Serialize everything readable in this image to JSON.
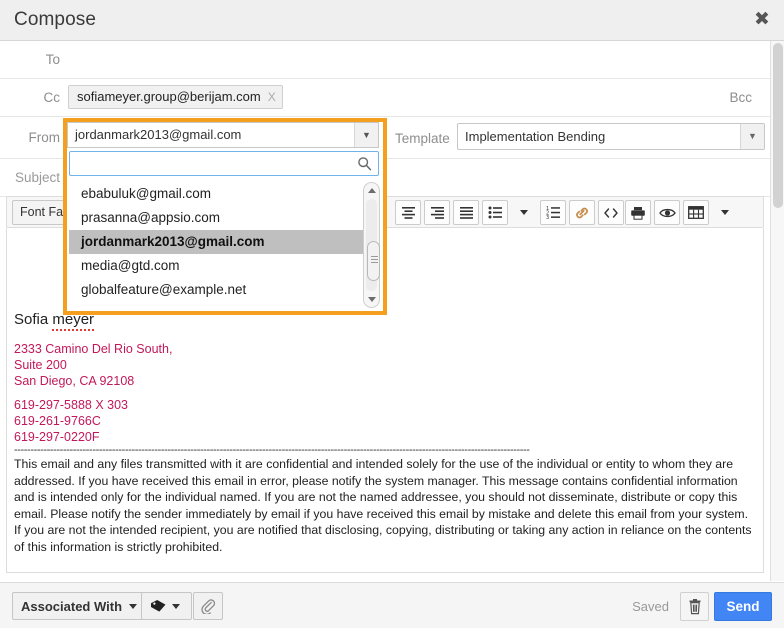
{
  "window": {
    "title": "Compose",
    "close_label": "✖"
  },
  "fields": {
    "to": {
      "label": "To",
      "value": ""
    },
    "cc": {
      "label": "Cc",
      "chip": "sofiameyer.group@berijam.com",
      "chip_remove": "X"
    },
    "bcc": {
      "label": "Bcc"
    },
    "from": {
      "label": "From",
      "value": "jordanmark2013@gmail.com"
    },
    "subject": {
      "label": "Subject",
      "value": ""
    }
  },
  "template": {
    "label": "Template",
    "value": "Implementation Bending"
  },
  "from_dropdown": {
    "open": true,
    "selected": "jordanmark2013@gmail.com",
    "search_value": "",
    "search_placeholder": "",
    "options": [
      "ebabuluk@gmail.com",
      "prasanna@appsio.com",
      "jordanmark2013@gmail.com",
      "media@gtd.com",
      "globalfeature@example.net"
    ],
    "highlight_color": "#f59f1e"
  },
  "toolbar": {
    "font_family_label": "Font Fami",
    "buttons": [
      {
        "name": "align-center-icon",
        "label": ""
      },
      {
        "name": "align-right-icon",
        "label": ""
      },
      {
        "name": "align-justify-icon",
        "label": ""
      },
      {
        "name": "bullet-list-icon",
        "label": ""
      },
      {
        "name": "numbered-list-icon",
        "label": ""
      },
      {
        "name": "link-icon",
        "label": ""
      },
      {
        "name": "source-code-icon",
        "label": ""
      },
      {
        "name": "print-icon",
        "label": ""
      },
      {
        "name": "preview-eye-icon",
        "label": ""
      },
      {
        "name": "table-icon",
        "label": ""
      }
    ]
  },
  "body": {
    "signature_name": "Sofia ",
    "signature_name_misspelled": "meyer",
    "address_line1": "2333 Camino Del Rio South,",
    "address_line2": "Suite 200",
    "address_line3": "San Diego, CA 92108",
    "phone1": "619-297-5888 X 303",
    "phone2": "619-261-9766C",
    "phone3": "619-297-0220F",
    "divider": "--------------------------------------------------------------------------------------------------------------------------------------------------------------",
    "disclaimer": "This email and any files transmitted with it are confidential and intended solely for the use of the individual or entity to whom they are addressed. If you have received this email in error, please notify the system manager. This message contains confidential information and is intended only for the individual named. If you are not the named addressee, you should not disseminate, distribute or copy this email. Please notify the sender immediately by email if you have received this email by mistake and delete this email from your system. If you are not the intended recipient, you are notified that disclosing, copying, distributing or taking any action in reliance on the contents of this information is strictly prohibited.",
    "address_color": "#c2185b"
  },
  "footer": {
    "associated_with_label": "Associated With",
    "saved_label": "Saved",
    "send_label": "Send",
    "send_color": "#4285f4"
  }
}
